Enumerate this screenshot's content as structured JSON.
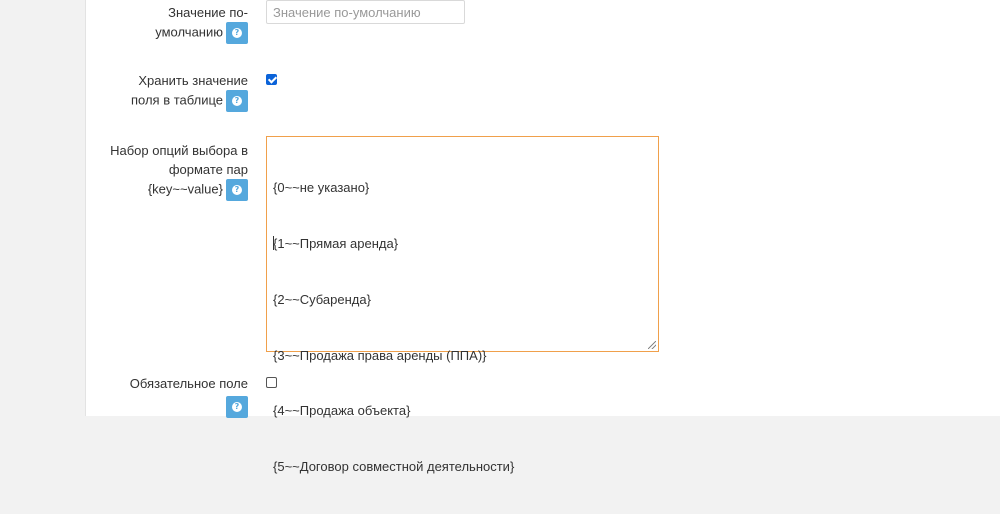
{
  "default_value": {
    "label_line1": "Значение по-",
    "label_line2": "умолчанию",
    "placeholder": "Значение по-умолчанию"
  },
  "store_in_table": {
    "label_line1": "Хранить значение",
    "label_line2": "поля в таблице",
    "checked": true
  },
  "options_set": {
    "label_line1": "Набор опций выбора в",
    "label_line2": "формате пар",
    "label_line3": "{key~~value}",
    "options": [
      "{0~~не указано}",
      "{1~~Прямая аренда}",
      "{2~~Субаренда}",
      "{3~~Продажа права аренды (ППА)}",
      "{4~~Продажа объекта}",
      "{5~~Договор совместной деятельности}"
    ]
  },
  "required_field": {
    "label": "Обязательное поле",
    "checked": false
  },
  "help_icon_glyph": "?",
  "colors": {
    "help_button": "#55a8dd",
    "checkbox_checked": "#0b63d9",
    "textarea_focus_border": "#f0a04b"
  }
}
